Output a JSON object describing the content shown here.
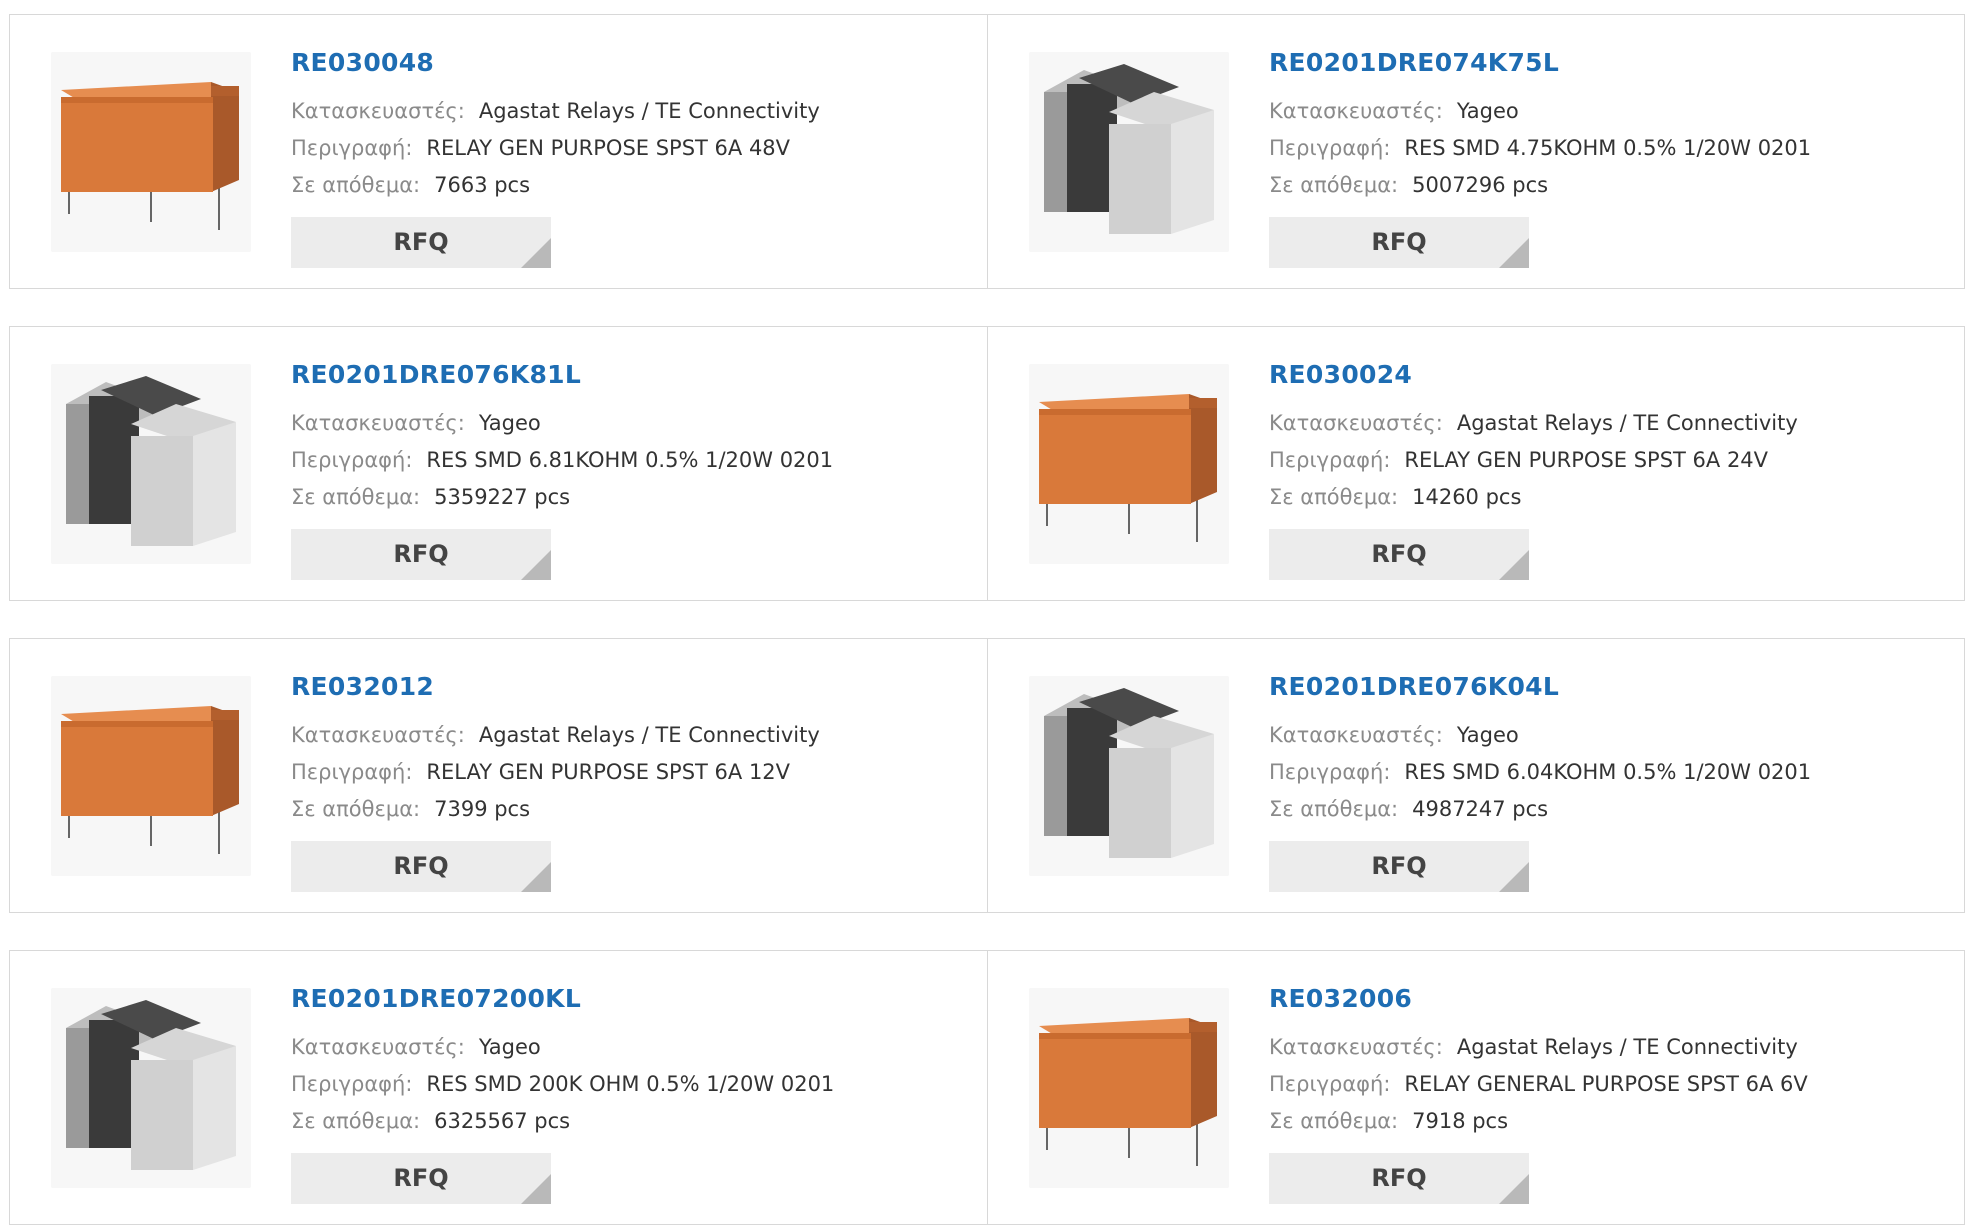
{
  "labels": {
    "manufacturer": "Κατασκευαστές:",
    "description": "Περιγραφή:",
    "stock": "Σε απόθεμα:",
    "rfq": "RFQ"
  },
  "products": [
    {
      "pn": "RE030048",
      "manufacturer": "Agastat Relays / TE Connectivity",
      "description": "RELAY GEN PURPOSE SPST 6A 48V",
      "stock": "7663 pcs",
      "image": "relay-icon"
    },
    {
      "pn": "RE0201DRE074K75L",
      "manufacturer": "Yageo",
      "description": "RES SMD 4.75KOHM 0.5% 1/20W 0201",
      "stock": "5007296 pcs",
      "image": "resistor-icon"
    },
    {
      "pn": "RE0201DRE076K81L",
      "manufacturer": "Yageo",
      "description": "RES SMD 6.81KOHM 0.5% 1/20W 0201",
      "stock": "5359227 pcs",
      "image": "resistor-icon"
    },
    {
      "pn": "RE030024",
      "manufacturer": "Agastat Relays / TE Connectivity",
      "description": "RELAY GEN PURPOSE SPST 6A 24V",
      "stock": "14260 pcs",
      "image": "relay-icon"
    },
    {
      "pn": "RE032012",
      "manufacturer": "Agastat Relays / TE Connectivity",
      "description": "RELAY GEN PURPOSE SPST 6A 12V",
      "stock": "7399 pcs",
      "image": "relay-icon"
    },
    {
      "pn": "RE0201DRE076K04L",
      "manufacturer": "Yageo",
      "description": "RES SMD 6.04KOHM 0.5% 1/20W 0201",
      "stock": "4987247 pcs",
      "image": "resistor-icon"
    },
    {
      "pn": "RE0201DRE07200KL",
      "manufacturer": "Yageo",
      "description": "RES SMD 200K OHM 0.5% 1/20W 0201",
      "stock": "6325567 pcs",
      "image": "resistor-icon"
    },
    {
      "pn": "RE032006",
      "manufacturer": "Agastat Relays / TE Connectivity",
      "description": "RELAY GENERAL PURPOSE SPST 6A 6V",
      "stock": "7918 pcs",
      "image": "relay-icon"
    }
  ],
  "colors": {
    "link": "#1e6db3",
    "relay": "#d9793a",
    "button": "#ececec"
  }
}
